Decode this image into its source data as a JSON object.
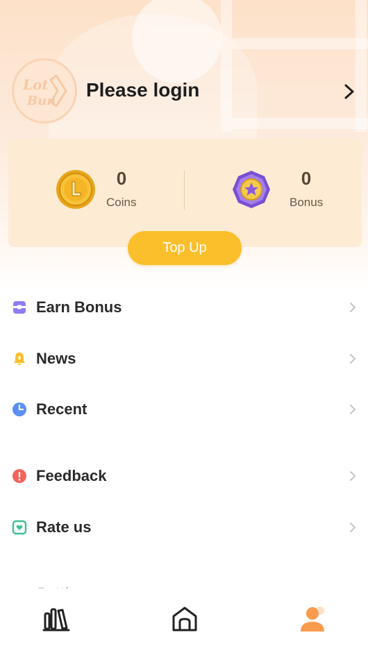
{
  "profile": {
    "title": "Please login",
    "avatar_icon": "lotebun-logo-icon",
    "avatar_logo_text": "LoteBun",
    "chevron_icon": "chevron-right-icon"
  },
  "wallet": {
    "coins": {
      "value": "0",
      "label": "Coins",
      "icon": "gold-coin-icon"
    },
    "bonus": {
      "value": "0",
      "label": "Bonus",
      "icon": "purple-star-badge-icon"
    },
    "topup_label": "Top Up"
  },
  "menu": [
    {
      "label": "Earn Bonus",
      "icon": "gift-box-icon",
      "icon_color": "#8e7cf0"
    },
    {
      "label": "News",
      "icon": "bell-icon",
      "icon_color": "#fbbf2c"
    },
    {
      "label": "Recent",
      "icon": "clock-icon",
      "icon_color": "#5b8ef5"
    },
    {
      "label": "Feedback",
      "icon": "exclamation-circle-icon",
      "icon_color": "#f2645a"
    },
    {
      "label": "Rate us",
      "icon": "heart-square-icon",
      "icon_color": "#3fbf8f"
    },
    {
      "label": "Setti",
      "icon": "settings-icon",
      "icon_color": "#333333"
    }
  ],
  "bottom_nav": [
    {
      "name": "library",
      "icon": "bookshelf-icon",
      "active": false
    },
    {
      "name": "home",
      "icon": "home-icon",
      "active": false
    },
    {
      "name": "profile",
      "icon": "user-icon",
      "active": true
    }
  ],
  "colors": {
    "accent": "#fbbf2c",
    "header_bg": "#fde1c9",
    "wallet_bg": "#fdebd4",
    "active_nav": "#f99a4d"
  }
}
